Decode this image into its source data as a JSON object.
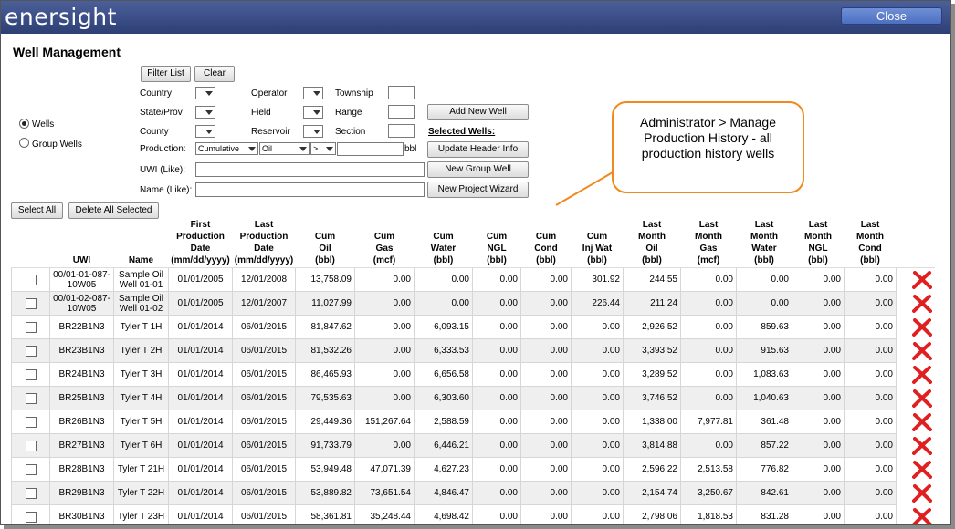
{
  "app": {
    "logo": "enersight",
    "close_label": "Close"
  },
  "page_title": "Well Management",
  "filters": {
    "filter_list_label": "Filter List",
    "clear_label": "Clear",
    "country_label": "Country",
    "state_label": "State/Prov",
    "county_label": "County",
    "operator_label": "Operator",
    "field_label": "Field",
    "reservoir_label": "Reservoir",
    "township_label": "Township",
    "range_label": "Range",
    "section_label": "Section",
    "production_label": "Production:",
    "production_type": "Cumulative",
    "production_fluid": "Oil",
    "production_op": ">",
    "production_unit": "bbl",
    "uwi_label": "UWI (Like):",
    "name_label": "Name (Like):"
  },
  "mode": {
    "wells_label": "Wells",
    "group_wells_label": "Group Wells",
    "selected": "Wells"
  },
  "actions": {
    "add_new_well": "Add New Well",
    "selected_wells": "Selected Wells:",
    "update_header_info": "Update Header Info",
    "new_group_well": "New Group Well",
    "new_project_wizard": "New Project Wizard",
    "select_all": "Select All",
    "delete_all_selected": "Delete All Selected"
  },
  "callout": {
    "text": "Administrator > Manage Production History - all production history wells"
  },
  "table": {
    "columns": [
      {
        "key": "uwi",
        "label": "UWI"
      },
      {
        "key": "name",
        "label": "Name"
      },
      {
        "key": "first",
        "label": "First\nProduction\nDate\n(mm/dd/yyyy)"
      },
      {
        "key": "last",
        "label": "Last\nProduction\nDate\n(mm/dd/yyyy)"
      },
      {
        "key": "cum_oil",
        "label": "Cum\nOil\n(bbl)"
      },
      {
        "key": "cum_gas",
        "label": "Cum\nGas\n(mcf)"
      },
      {
        "key": "cum_water",
        "label": "Cum\nWater\n(bbl)"
      },
      {
        "key": "cum_ngl",
        "label": "Cum\nNGL\n(bbl)"
      },
      {
        "key": "cum_cond",
        "label": "Cum\nCond\n(bbl)"
      },
      {
        "key": "cum_injwat",
        "label": "Cum\nInj Wat\n(bbl)"
      },
      {
        "key": "lm_oil",
        "label": "Last\nMonth\nOil\n(bbl)"
      },
      {
        "key": "lm_gas",
        "label": "Last\nMonth\nGas\n(mcf)"
      },
      {
        "key": "lm_water",
        "label": "Last\nMonth\nWater\n(bbl)"
      },
      {
        "key": "lm_ngl",
        "label": "Last\nMonth\nNGL\n(bbl)"
      },
      {
        "key": "lm_cond",
        "label": "Last\nMonth\nCond\n(bbl)"
      }
    ],
    "rows": [
      {
        "uwi": "00/01-01-087-10W05",
        "name": "Sample Oil Well 01-01",
        "first": "01/01/2005",
        "last": "12/01/2008",
        "cum_oil": "13,758.09",
        "cum_gas": "0.00",
        "cum_water": "0.00",
        "cum_ngl": "0.00",
        "cum_cond": "0.00",
        "cum_injwat": "301.92",
        "lm_oil": "244.55",
        "lm_gas": "0.00",
        "lm_water": "0.00",
        "lm_ngl": "0.00",
        "lm_cond": "0.00"
      },
      {
        "uwi": "00/01-02-087-10W05",
        "name": "Sample Oil Well 01-02",
        "first": "01/01/2005",
        "last": "12/01/2007",
        "cum_oil": "11,027.99",
        "cum_gas": "0.00",
        "cum_water": "0.00",
        "cum_ngl": "0.00",
        "cum_cond": "0.00",
        "cum_injwat": "226.44",
        "lm_oil": "211.24",
        "lm_gas": "0.00",
        "lm_water": "0.00",
        "lm_ngl": "0.00",
        "lm_cond": "0.00"
      },
      {
        "uwi": "BR22B1N3",
        "name": "Tyler T 1H",
        "first": "01/01/2014",
        "last": "06/01/2015",
        "cum_oil": "81,847.62",
        "cum_gas": "0.00",
        "cum_water": "6,093.15",
        "cum_ngl": "0.00",
        "cum_cond": "0.00",
        "cum_injwat": "0.00",
        "lm_oil": "2,926.52",
        "lm_gas": "0.00",
        "lm_water": "859.63",
        "lm_ngl": "0.00",
        "lm_cond": "0.00"
      },
      {
        "uwi": "BR23B1N3",
        "name": "Tyler T 2H",
        "first": "01/01/2014",
        "last": "06/01/2015",
        "cum_oil": "81,532.26",
        "cum_gas": "0.00",
        "cum_water": "6,333.53",
        "cum_ngl": "0.00",
        "cum_cond": "0.00",
        "cum_injwat": "0.00",
        "lm_oil": "3,393.52",
        "lm_gas": "0.00",
        "lm_water": "915.63",
        "lm_ngl": "0.00",
        "lm_cond": "0.00"
      },
      {
        "uwi": "BR24B1N3",
        "name": "Tyler T 3H",
        "first": "01/01/2014",
        "last": "06/01/2015",
        "cum_oil": "86,465.93",
        "cum_gas": "0.00",
        "cum_water": "6,656.58",
        "cum_ngl": "0.00",
        "cum_cond": "0.00",
        "cum_injwat": "0.00",
        "lm_oil": "3,289.52",
        "lm_gas": "0.00",
        "lm_water": "1,083.63",
        "lm_ngl": "0.00",
        "lm_cond": "0.00"
      },
      {
        "uwi": "BR25B1N3",
        "name": "Tyler T 4H",
        "first": "01/01/2014",
        "last": "06/01/2015",
        "cum_oil": "79,535.63",
        "cum_gas": "0.00",
        "cum_water": "6,303.60",
        "cum_ngl": "0.00",
        "cum_cond": "0.00",
        "cum_injwat": "0.00",
        "lm_oil": "3,746.52",
        "lm_gas": "0.00",
        "lm_water": "1,040.63",
        "lm_ngl": "0.00",
        "lm_cond": "0.00"
      },
      {
        "uwi": "BR26B1N3",
        "name": "Tyler T 5H",
        "first": "01/01/2014",
        "last": "06/01/2015",
        "cum_oil": "29,449.36",
        "cum_gas": "151,267.64",
        "cum_water": "2,588.59",
        "cum_ngl": "0.00",
        "cum_cond": "0.00",
        "cum_injwat": "0.00",
        "lm_oil": "1,338.00",
        "lm_gas": "7,977.81",
        "lm_water": "361.48",
        "lm_ngl": "0.00",
        "lm_cond": "0.00"
      },
      {
        "uwi": "BR27B1N3",
        "name": "Tyler T 6H",
        "first": "01/01/2014",
        "last": "06/01/2015",
        "cum_oil": "91,733.79",
        "cum_gas": "0.00",
        "cum_water": "6,446.21",
        "cum_ngl": "0.00",
        "cum_cond": "0.00",
        "cum_injwat": "0.00",
        "lm_oil": "3,814.88",
        "lm_gas": "0.00",
        "lm_water": "857.22",
        "lm_ngl": "0.00",
        "lm_cond": "0.00"
      },
      {
        "uwi": "BR28B1N3",
        "name": "Tyler T 21H",
        "first": "01/01/2014",
        "last": "06/01/2015",
        "cum_oil": "53,949.48",
        "cum_gas": "47,071.39",
        "cum_water": "4,627.23",
        "cum_ngl": "0.00",
        "cum_cond": "0.00",
        "cum_injwat": "0.00",
        "lm_oil": "2,596.22",
        "lm_gas": "2,513.58",
        "lm_water": "776.82",
        "lm_ngl": "0.00",
        "lm_cond": "0.00"
      },
      {
        "uwi": "BR29B1N3",
        "name": "Tyler T 22H",
        "first": "01/01/2014",
        "last": "06/01/2015",
        "cum_oil": "53,889.82",
        "cum_gas": "73,651.54",
        "cum_water": "4,846.47",
        "cum_ngl": "0.00",
        "cum_cond": "0.00",
        "cum_injwat": "0.00",
        "lm_oil": "2,154.74",
        "lm_gas": "3,250.67",
        "lm_water": "842.61",
        "lm_ngl": "0.00",
        "lm_cond": "0.00"
      },
      {
        "uwi": "BR30B1N3",
        "name": "Tyler T 23H",
        "first": "01/01/2014",
        "last": "06/01/2015",
        "cum_oil": "58,361.81",
        "cum_gas": "35,248.44",
        "cum_water": "4,698.42",
        "cum_ngl": "0.00",
        "cum_cond": "0.00",
        "cum_injwat": "0.00",
        "lm_oil": "2,798.06",
        "lm_gas": "1,818.53",
        "lm_water": "831.28",
        "lm_ngl": "0.00",
        "lm_cond": "0.00"
      }
    ]
  },
  "colors": {
    "topbar": "#3a4c86",
    "close_button": "#5b7cc9",
    "callout_border": "#f08a1c",
    "delete_x": "#e02020",
    "row_alt": "#efefef"
  },
  "icons": {
    "row_delete": "red-x-delete-icon",
    "row_select": "checkbox"
  }
}
